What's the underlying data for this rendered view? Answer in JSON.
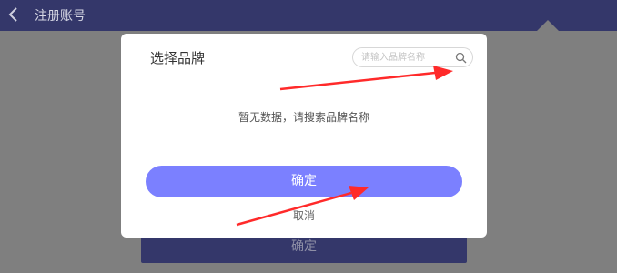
{
  "topbar": {
    "title": "注册账号"
  },
  "background": {
    "confirm_label": "确定"
  },
  "modal": {
    "title": "选择品牌",
    "search": {
      "placeholder": "请输入品牌名称",
      "value": ""
    },
    "empty_text": "暂无数据，请搜索品牌名称",
    "confirm_label": "确定",
    "cancel_label": "取消"
  },
  "colors": {
    "header_bg": "#34376a",
    "accent": "#7b80ff",
    "overlay": "#7f7f7f",
    "annotation": "#ff2a2a"
  },
  "icons": [
    "back-arrow-icon",
    "search-icon"
  ]
}
